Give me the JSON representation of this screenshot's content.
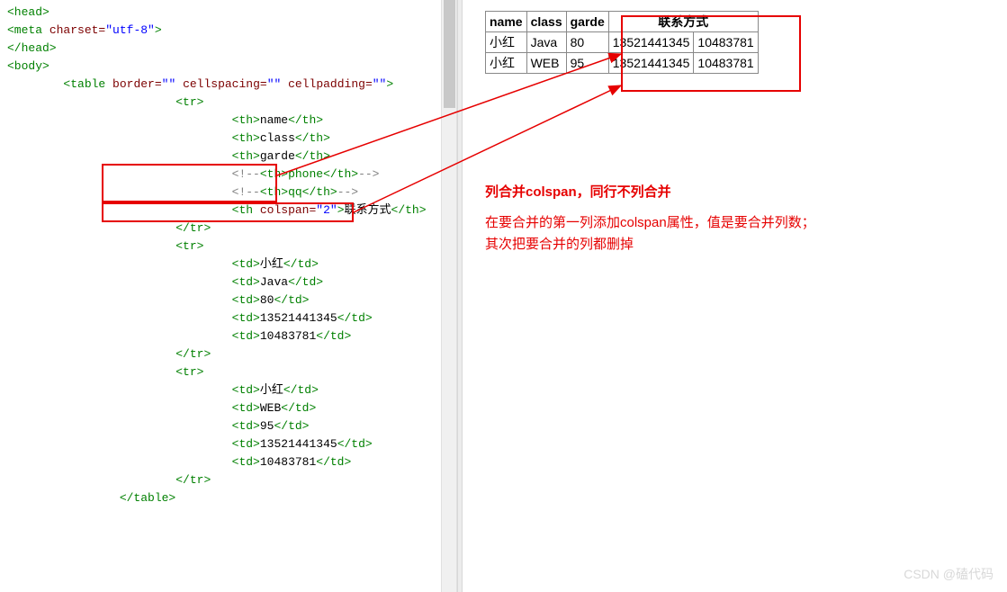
{
  "code_lines": [
    {
      "indent": 0,
      "kind": "tag",
      "raw": "<head>"
    },
    {
      "indent": 0,
      "kind": "selfclose",
      "tag": "meta",
      "attrs": [
        {
          "n": "charset",
          "v": "utf-8"
        }
      ]
    },
    {
      "indent": 0,
      "kind": "tag",
      "raw": "</head>"
    },
    {
      "indent": 0,
      "kind": "blank"
    },
    {
      "indent": 0,
      "kind": "tag",
      "raw": "<body>"
    },
    {
      "indent": 1,
      "kind": "open",
      "tag": "table",
      "attrs": [
        {
          "n": "border",
          "v": ""
        },
        {
          "n": "cellspacing",
          "v": ""
        },
        {
          "n": "cellpadding",
          "v": ""
        }
      ]
    },
    {
      "indent": 3,
      "kind": "tag",
      "raw": "<tr>"
    },
    {
      "indent": 4,
      "kind": "cell",
      "tag": "th",
      "text": "name"
    },
    {
      "indent": 4,
      "kind": "cell",
      "tag": "th",
      "text": "class"
    },
    {
      "indent": 4,
      "kind": "cell",
      "tag": "th",
      "text": "garde"
    },
    {
      "indent": 4,
      "kind": "comment",
      "inner": "<th>phone</th>"
    },
    {
      "indent": 4,
      "kind": "comment",
      "inner": "<th>qq</th>"
    },
    {
      "indent": 4,
      "kind": "cellattr",
      "tag": "th",
      "attrs": [
        {
          "n": "colspan",
          "v": "2"
        }
      ],
      "text": "联系方式"
    },
    {
      "indent": 3,
      "kind": "tag",
      "raw": "</tr>"
    },
    {
      "indent": 3,
      "kind": "tag",
      "raw": "<tr>"
    },
    {
      "indent": 4,
      "kind": "cell",
      "tag": "td",
      "text": "小红"
    },
    {
      "indent": 4,
      "kind": "cell",
      "tag": "td",
      "text": "Java"
    },
    {
      "indent": 4,
      "kind": "cell",
      "tag": "td",
      "text": "80"
    },
    {
      "indent": 4,
      "kind": "cell",
      "tag": "td",
      "text": "13521441345"
    },
    {
      "indent": 4,
      "kind": "cell",
      "tag": "td",
      "text": "10483781"
    },
    {
      "indent": 3,
      "kind": "tag",
      "raw": "</tr>"
    },
    {
      "indent": 3,
      "kind": "tag",
      "raw": "<tr>"
    },
    {
      "indent": 4,
      "kind": "cell",
      "tag": "td",
      "text": "小红"
    },
    {
      "indent": 4,
      "kind": "cell",
      "tag": "td",
      "text": "WEB"
    },
    {
      "indent": 4,
      "kind": "cell",
      "tag": "td",
      "text": "95"
    },
    {
      "indent": 4,
      "kind": "cell",
      "tag": "td",
      "text": "13521441345"
    },
    {
      "indent": 4,
      "kind": "cell",
      "tag": "td",
      "text": "10483781"
    },
    {
      "indent": 3,
      "kind": "tag",
      "raw": "</tr>"
    },
    {
      "indent": 2,
      "kind": "tag",
      "raw": "</table>"
    }
  ],
  "table": {
    "headers": [
      "name",
      "class",
      "garde"
    ],
    "merged_header": "联系方式",
    "rows": [
      [
        "小红",
        "Java",
        "80",
        "13521441345",
        "10483781"
      ],
      [
        "小红",
        "WEB",
        "95",
        "13521441345",
        "10483781"
      ]
    ]
  },
  "annotation": {
    "title": "列合并colspan，同行不列合并",
    "desc_line1": "在要合并的第一列添加colspan属性，值是要合并列数；",
    "desc_line2": "其次把要合并的列都删掉"
  },
  "watermark": "CSDN @磕代码"
}
